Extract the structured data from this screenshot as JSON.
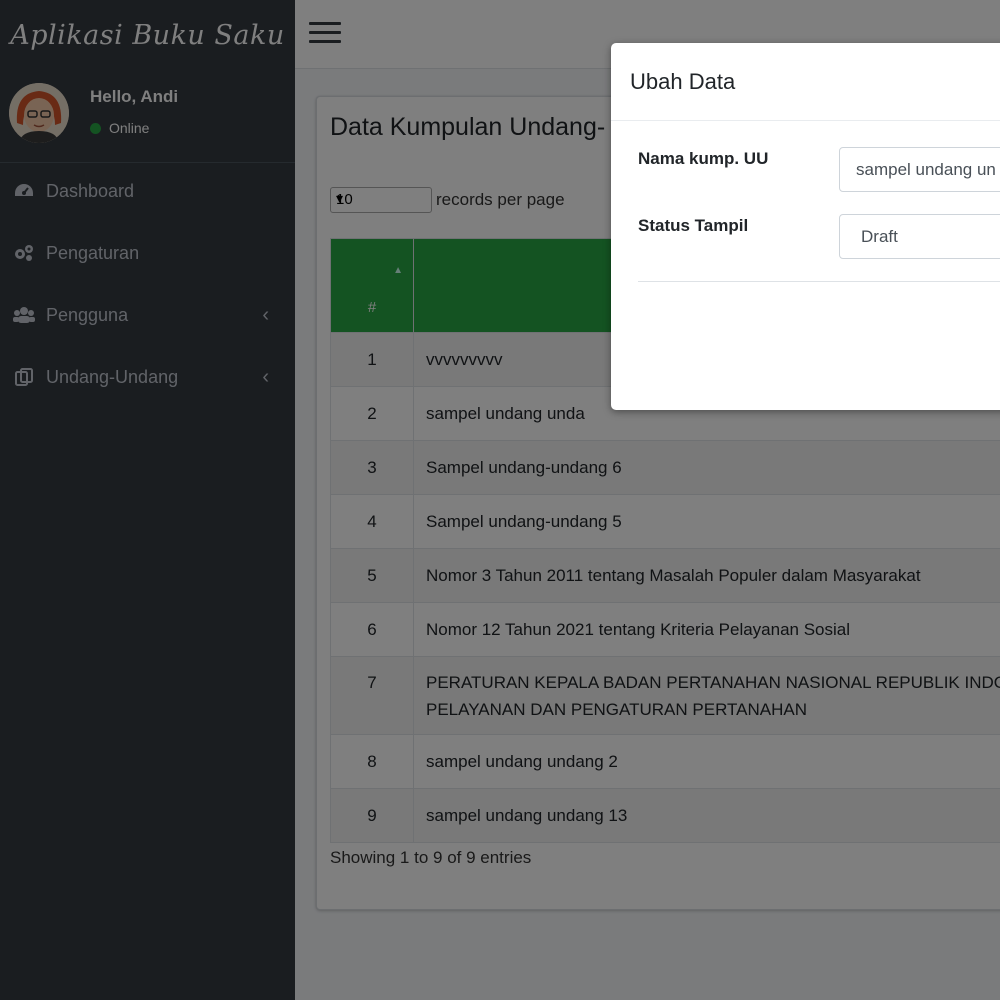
{
  "app": {
    "title": "Aplikasi Buku Saku"
  },
  "user": {
    "greeting": "Hello, Andi",
    "status": "Online"
  },
  "sidebar": {
    "items": [
      {
        "label": "Dashboard",
        "icon": "dashboard-icon"
      },
      {
        "label": "Pengaturan",
        "icon": "gears-icon"
      },
      {
        "label": "Pengguna",
        "icon": "users-icon",
        "chevron": "‹"
      },
      {
        "label": "Undang-Undang",
        "icon": "copy-icon",
        "chevron": "‹"
      }
    ]
  },
  "main": {
    "card_title": "Data Kumpulan Undang-",
    "length": {
      "value": "10",
      "label": "records per page"
    },
    "table": {
      "headers": [
        "#",
        ""
      ],
      "rows": [
        [
          "1",
          "vvvvvvvvv"
        ],
        [
          "2",
          "sampel undang unda"
        ],
        [
          "3",
          "Sampel undang-undang 6"
        ],
        [
          "4",
          "Sampel undang-undang 5"
        ],
        [
          "5",
          "Nomor 3 Tahun 2011 tentang Masalah Populer dalam Masyarakat"
        ],
        [
          "6",
          "Nomor 12 Tahun 2021 tentang Kriteria Pelayanan Sosial"
        ],
        [
          "7",
          "PERATURAN KEPALA BADAN PERTANAHAN NASIONAL REPUBLIK INDO",
          "PELAYANAN DAN PENGATURAN PERTANAHAN"
        ],
        [
          "8",
          "sampel undang undang 2"
        ],
        [
          "9",
          "sampel undang undang 13"
        ]
      ]
    },
    "info": "Showing 1 to 9 of 9 entries"
  },
  "modal": {
    "title": "Ubah Data",
    "fields": [
      {
        "label": "Nama kump. UU",
        "value": "sampel undang un"
      },
      {
        "label": "Status Tampil",
        "value": "Draft"
      }
    ]
  },
  "colors": {
    "sidebar": "#343a40",
    "accent": "#28a745",
    "status_dot": "#28a745"
  }
}
